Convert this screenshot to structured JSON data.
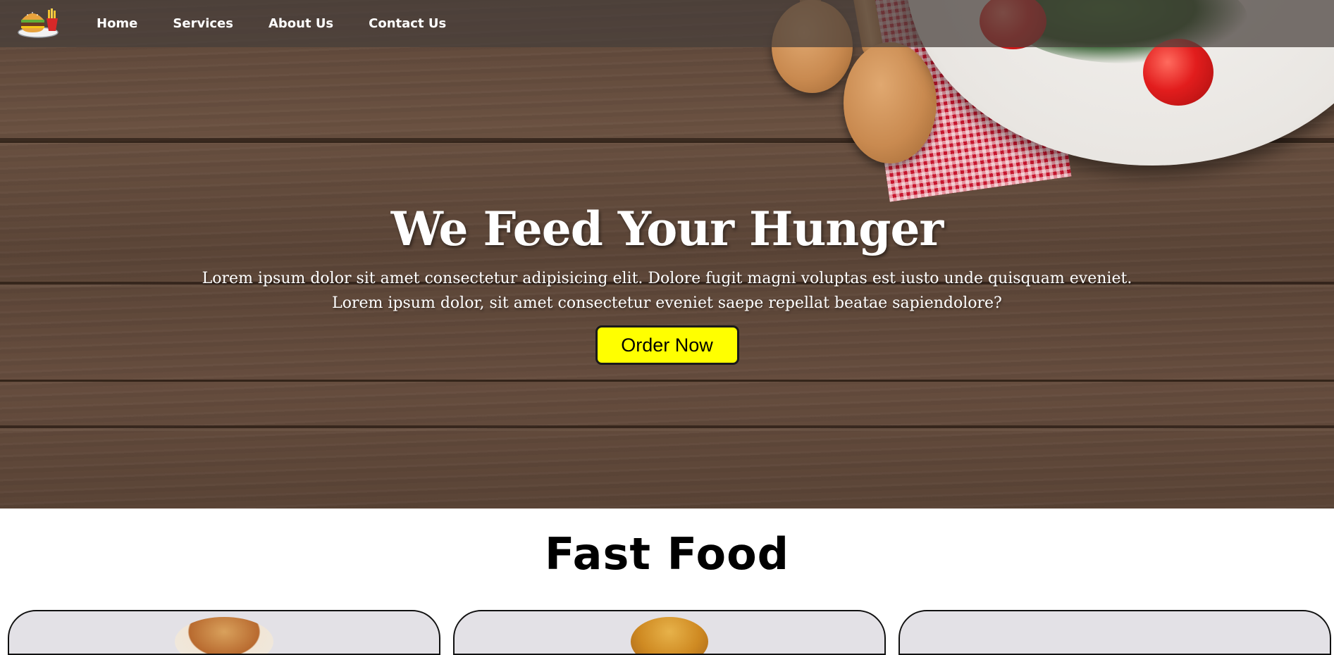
{
  "nav": {
    "logo_name": "burger-fries-logo-icon",
    "links": [
      "Home",
      "Services",
      "About Us",
      "Contact Us"
    ]
  },
  "hero": {
    "title": "We Feed Your Hunger",
    "text_line1": "Lorem ipsum dolor sit amet consectetur adipisicing elit. Dolore fugit magni voluptas est iusto unde quisquam eveniet.",
    "text_line2": "Lorem ipsum dolor, sit amet consectetur eveniet saepe repellat beatae sapiendolore?",
    "button_label": "Order Now"
  },
  "section": {
    "title": "Fast Food"
  },
  "colors": {
    "button_bg": "#ffff00",
    "nav_bg": "rgba(70,62,58,0.72)",
    "text_light": "#ffffff"
  }
}
